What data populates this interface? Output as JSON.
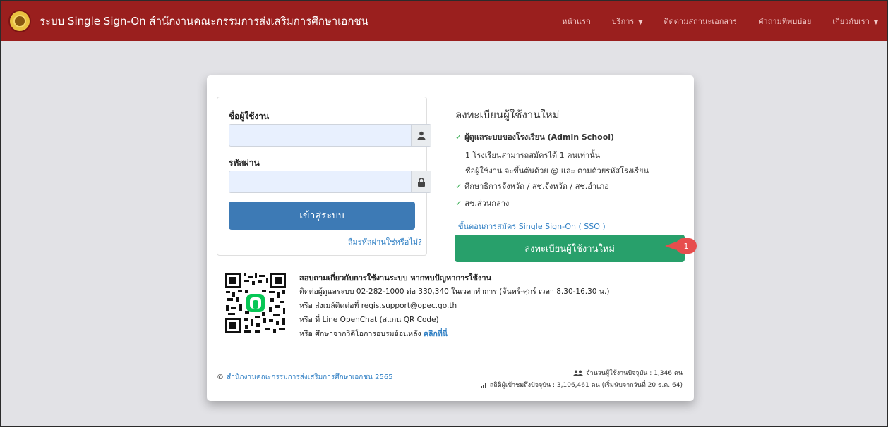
{
  "header": {
    "brand": "ระบบ Single Sign-On สำนักงานคณะกรรมการส่งเสริมการศึกษาเอกชน",
    "nav": [
      {
        "label": "หน้าแรก",
        "caret": false
      },
      {
        "label": "บริการ",
        "caret": true
      },
      {
        "label": "ติดตามสถานะเอกสาร",
        "caret": false
      },
      {
        "label": "คำถามที่พบบ่อย",
        "caret": false
      },
      {
        "label": "เกี่ยวกับเรา",
        "caret": true
      }
    ],
    "caret_glyph": "▼"
  },
  "login": {
    "username_label": "ชื่อผู้ใช้งาน",
    "username_value": "",
    "password_label": "รหัสผ่าน",
    "password_value": "",
    "submit_label": "เข้าสู่ระบบ",
    "forgot_label": "ลืมรหัสผ่านใช่หรือไม่?"
  },
  "register": {
    "title": "ลงทะเบียนผู้ใช้งานใหม่",
    "check_glyph": "✓",
    "item1": "ผู้ดูแลระบบของโรงเรียน (Admin School)",
    "item1_note1": "1 โรงเรียนสามารถสมัครได้ 1 คนเท่านั้น",
    "item1_note2": "ชื่อผู้ใช้งาน จะขึ้นต้นด้วย @ และ ตามด้วยรหัสโรงเรียน",
    "item2": "ศึกษาธิการจังหวัด / สช.จังหวัด / สช.อำเภอ",
    "item3": "สช.ส่วนกลาง",
    "sso_link": "ขั้นตอนการสมัคร Single Sign-On ( SSO )",
    "button_label": "ลงทะเบียนผู้ใช้งานใหม่",
    "step_badge": "1"
  },
  "contact": {
    "title": "สอบถามเกี่ยวกับการใช้งานระบบ หากพบปัญหาการใช้งาน",
    "line1": "ติดต่อผู้ดูแลระบบ 02-282-1000 ต่อ 330,340 ในเวลาทำการ (จันทร์-ศุกร์ เวลา 8.30-16.30 น.)",
    "line2": "หรือ ส่งเมล์ติดต่อที่ regis.support@opec.go.th",
    "line3": "หรือ ที่ Line OpenChat (สแกน QR Code)",
    "line4_text": "หรือ ศึกษาจากวิดีโอการอบรมย้อนหลัง",
    "line4_link": "คลิกที่นี่"
  },
  "footer": {
    "copyright_symbol": "©",
    "copyright": "สำนักงานคณะกรรมการส่งเสริมการศึกษาเอกชน 2565",
    "users_online": "จำนวนผู้ใช้งานปัจจุบัน : 1,346 คน",
    "visitors": "สถิติผู้เข้าชมถึงปัจจุบัน : 3,106,461 คน (เริ่มนับจากวันที่ 20 ธ.ค. 64)"
  },
  "colors": {
    "navbar": "#9a1f1e",
    "primary_button": "#3d7ab5",
    "success_button": "#28a06b",
    "badge": "#e74d4d",
    "link": "#2f7fc4"
  }
}
